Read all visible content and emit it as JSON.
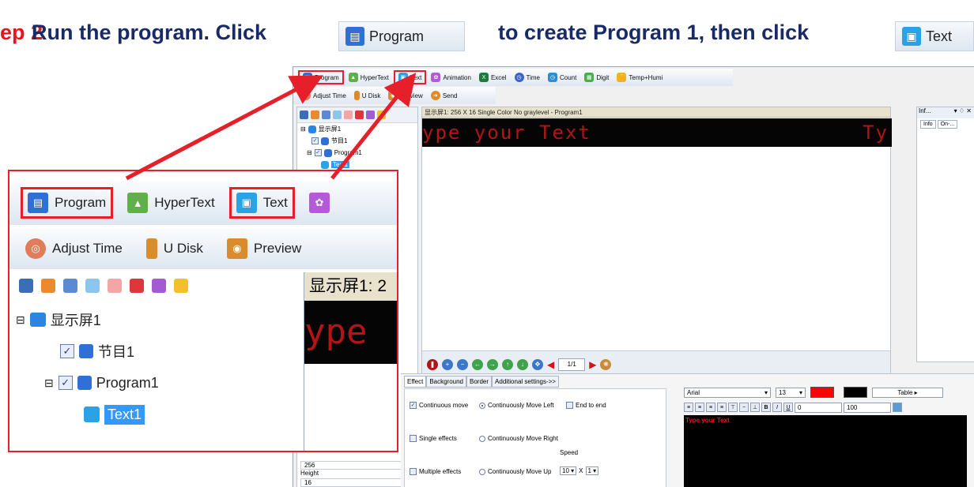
{
  "instruction": {
    "step": "ep 2",
    "text_before": "Run the program. Click",
    "text_mid": "to create Program 1, then click",
    "program_button": "Program",
    "text_button": "Text"
  },
  "toolbar": {
    "row1": [
      "Program",
      "HyperText",
      "Text",
      "Animation",
      "Excel",
      "Time",
      "Count",
      "Digit",
      "Temp+Humi"
    ],
    "row2": [
      "Adjust Time",
      "U Disk",
      "Preview",
      "Send"
    ]
  },
  "tree": {
    "screen": "显示屏1",
    "node1": "节目1",
    "program": "Program1",
    "text": "Text1"
  },
  "editor": {
    "title": "显示屏1: 256 X 16  Single Color No graylevel - Program1",
    "led_text": "ype your Text",
    "led_text_right": "Ty",
    "page": "1/1"
  },
  "info_panel": {
    "title": "Inf...",
    "tab1": "Info",
    "tab2": "On-..."
  },
  "left_fields": {
    "width_value": "256",
    "height_label": "Height",
    "height_value": "16"
  },
  "bottom_tabs": [
    "Effect",
    "Background",
    "Border",
    "Additional settings->>"
  ],
  "effects": {
    "continuous_move": "Continuous move",
    "single_effects": "Single effects",
    "multiple_effects": "Multiple effects",
    "move_left": "Continuously Move Left",
    "move_right": "Continuously Move Right",
    "move_up": "Continuously Move Up",
    "end_to_end": "End to end",
    "speed_label": "Speed",
    "speed_value": "10",
    "x_label": "X",
    "multiplier": "1"
  },
  "text_editor": {
    "font": "Arial",
    "size": "13",
    "table_label": "Table",
    "spacing": "0",
    "scale": "100",
    "content": "Type your Text",
    "text_color": "#ff0000",
    "bg_color": "#000000"
  },
  "zoom": {
    "toolbar_row1": [
      "Program",
      "HyperText",
      "Text"
    ],
    "toolbar_row2": [
      "Adjust Time",
      "U Disk",
      "Preview"
    ],
    "title_partial": "显示屏1: 2",
    "led_partial": "ype"
  },
  "colors": {
    "accent_red": "#e5202a",
    "heading_navy": "#1a2a66",
    "led_red": "#b3141a",
    "selection_blue": "#3399ff"
  }
}
